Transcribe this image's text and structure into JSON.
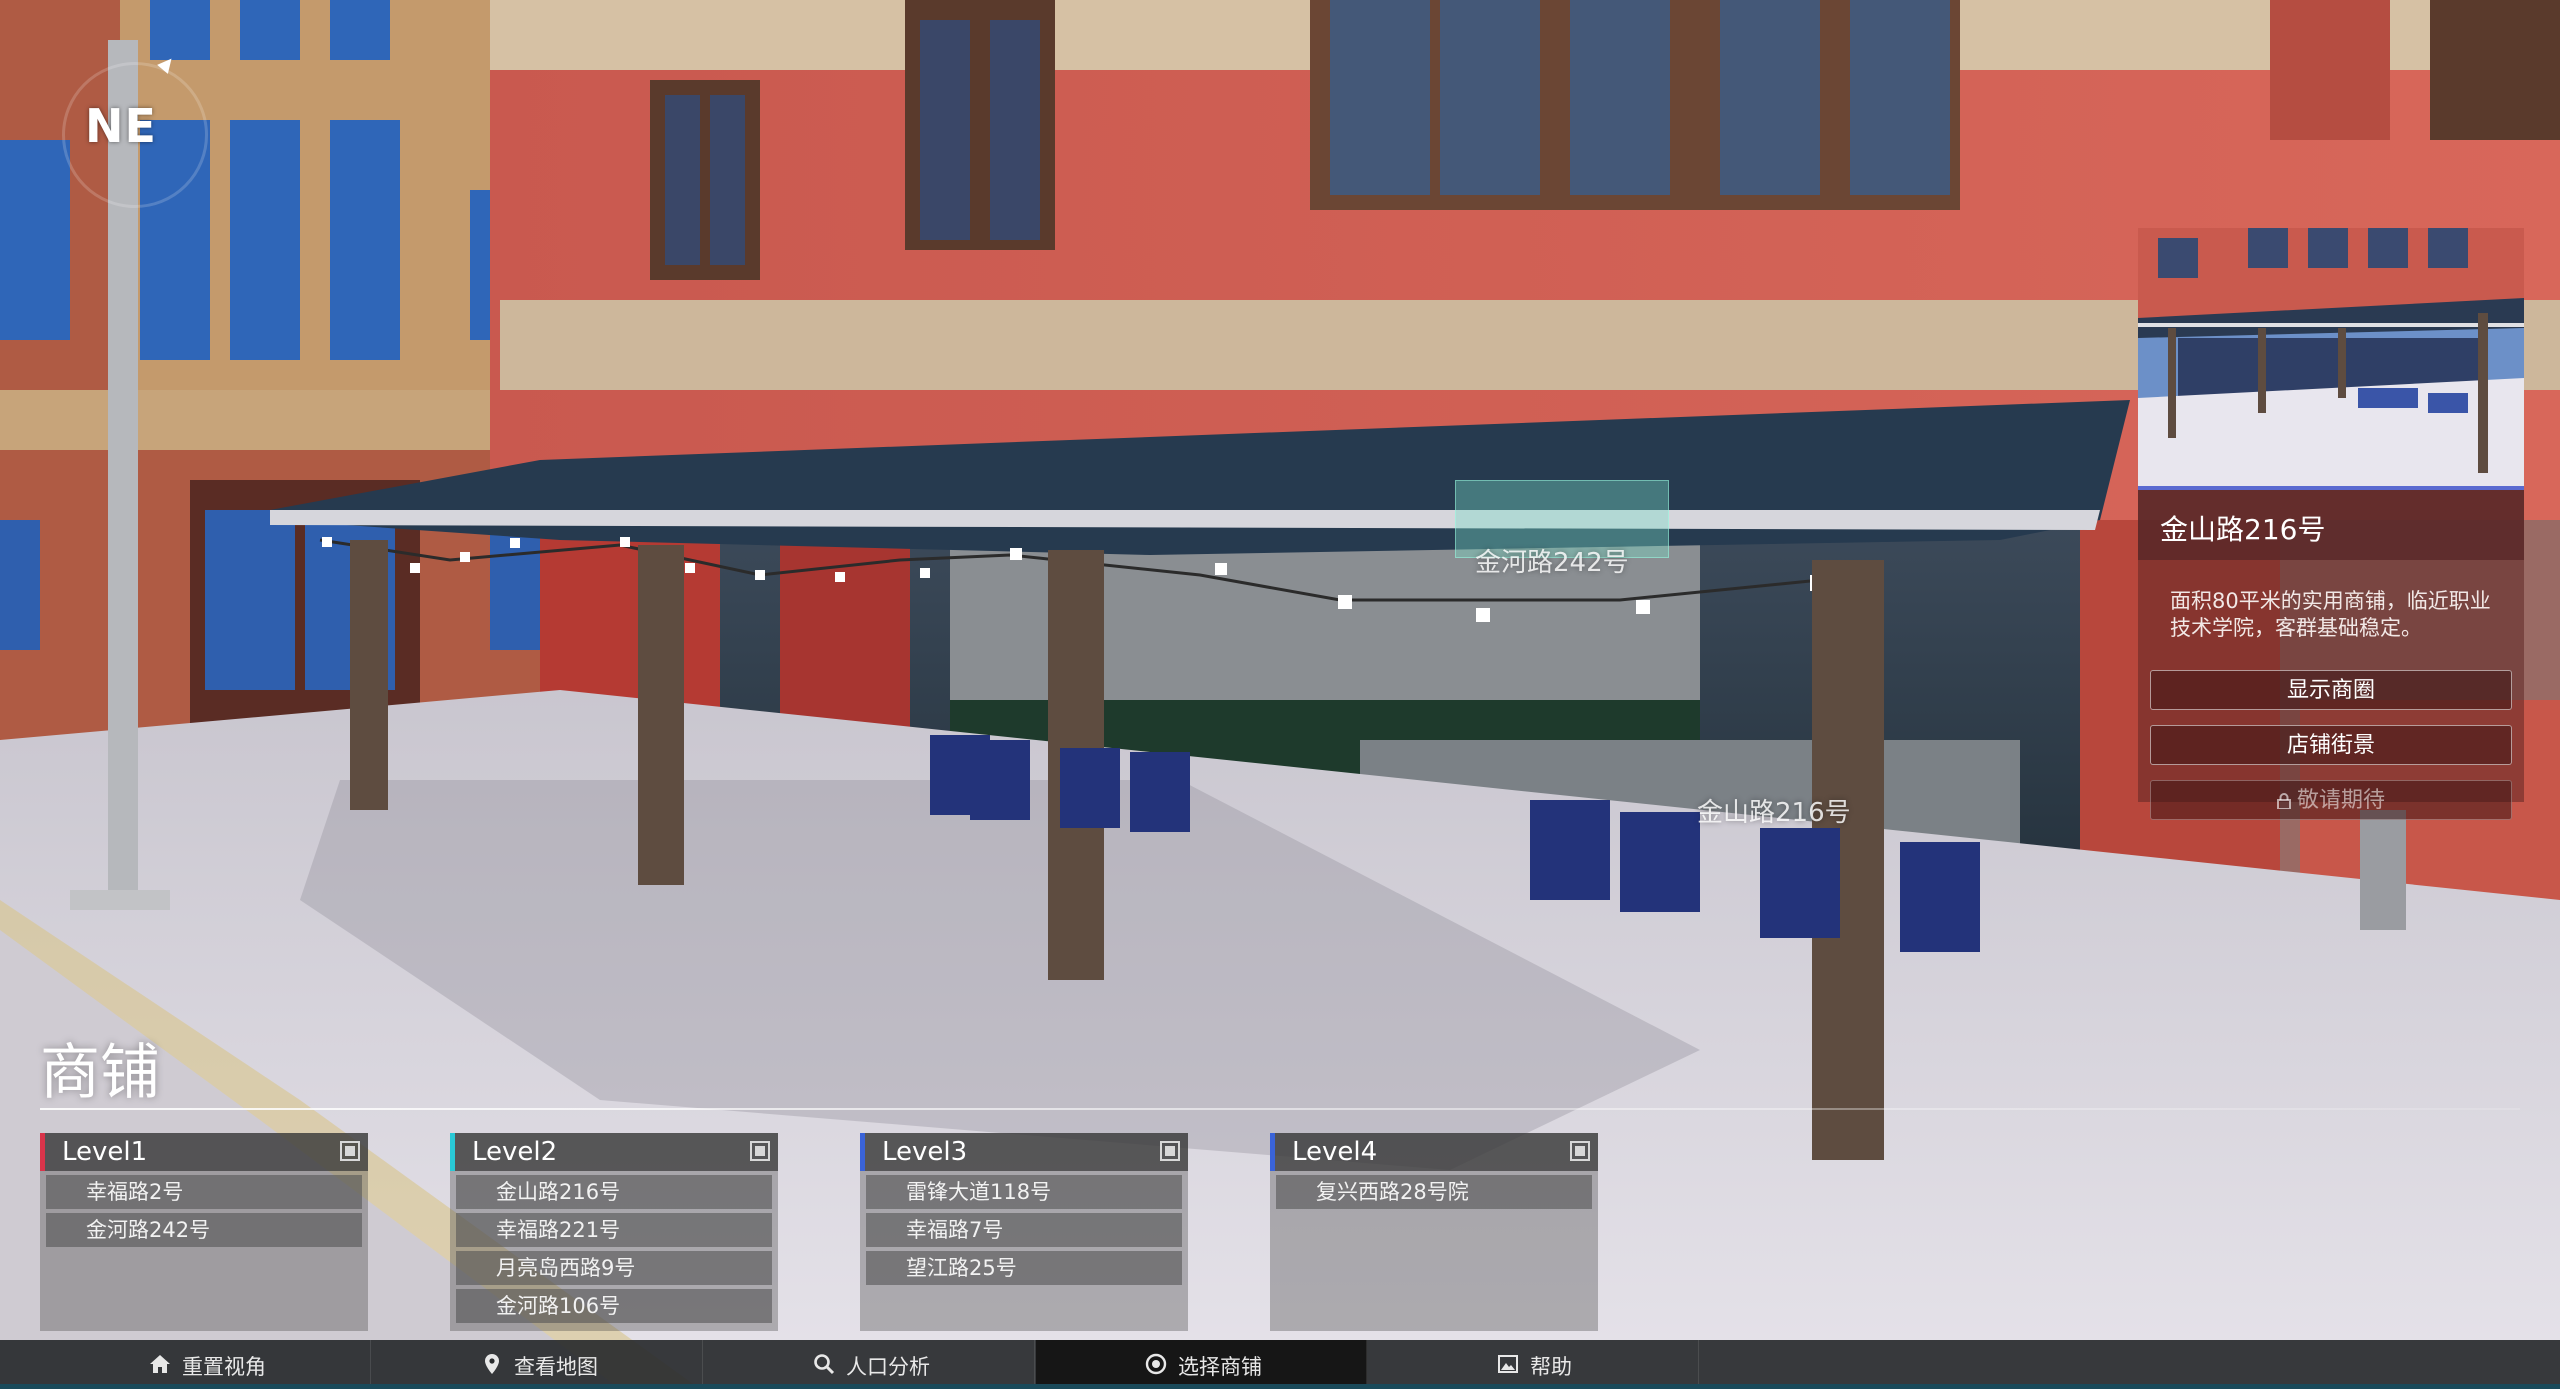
{
  "compass": {
    "label": "NE"
  },
  "map_labels": [
    {
      "text": "金河路242号"
    },
    {
      "text": "金山路216号"
    }
  ],
  "info_panel": {
    "title": "金山路216号",
    "description": "面积80平米的实用商铺，临近职业技术学院，客群基础稳定。",
    "buttons": [
      {
        "label": "显示商圈",
        "enabled": true
      },
      {
        "label": "店铺街景",
        "enabled": true
      },
      {
        "label": "敬请期待",
        "enabled": false,
        "icon": "lock-icon"
      }
    ]
  },
  "shop_selector": {
    "title": "商铺",
    "levels": [
      {
        "name": "Level1",
        "accent": "#d9344a",
        "shops": [
          "幸福路2号",
          "金河路242号"
        ]
      },
      {
        "name": "Level2",
        "accent": "#29c9d6",
        "shops": [
          "金山路216号",
          "幸福路221号",
          "月亮岛西路9号",
          "金河路106号"
        ]
      },
      {
        "name": "Level3",
        "accent": "#3a63d8",
        "shops": [
          "雷锋大道118号",
          "幸福路7号",
          "望江路25号"
        ]
      },
      {
        "name": "Level4",
        "accent": "#3a63d8",
        "shops": [
          "复兴西路28号院"
        ]
      }
    ]
  },
  "nav": [
    {
      "label": "重置视角",
      "icon": "home-icon",
      "active": false
    },
    {
      "label": "查看地图",
      "icon": "map-pin-icon",
      "active": false
    },
    {
      "label": "人口分析",
      "icon": "search-icon",
      "active": false
    },
    {
      "label": "选择商铺",
      "icon": "target-icon",
      "active": true
    },
    {
      "label": "帮助",
      "icon": "image-icon",
      "active": false
    }
  ]
}
